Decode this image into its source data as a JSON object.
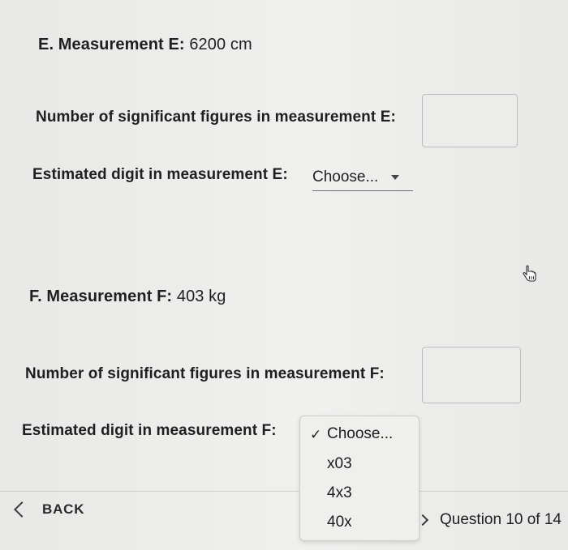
{
  "measurement_e": {
    "heading_prefix": "E. Measurement E:",
    "heading_value": "6200 cm",
    "sig_figs_label": "Number of significant figures in measurement E:",
    "sig_figs_value": "",
    "estimated_label": "Estimated digit in measurement E:",
    "estimated_selected": "Choose..."
  },
  "measurement_f": {
    "heading_prefix": "F. Measurement F:",
    "heading_value": "403 kg",
    "sig_figs_label": "Number of significant figures in measurement F:",
    "sig_figs_value": "",
    "estimated_label": "Estimated digit in measurement F:",
    "dropdown": {
      "check_mark": "✓",
      "options": [
        "Choose...",
        "x03",
        "4x3",
        "40x"
      ],
      "selected": "Choose..."
    }
  },
  "footer": {
    "back_label": "BACK",
    "question_status": "Question 10 of 14"
  },
  "icons": {
    "cursor": "hand-pointer-icon",
    "back": "chevron-left-icon",
    "next": "chevron-right-icon"
  }
}
